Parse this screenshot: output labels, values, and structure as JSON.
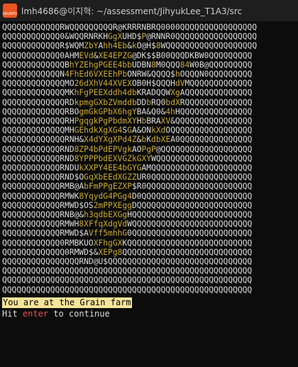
{
  "window": {
    "title": "lmh4686@이지혁: ~/assessment/JihyukLee_T1A3/src",
    "icon_label": "UBUNTU"
  },
  "art_lines": [
    "QQQQQQQQQQQQRWQQQQQQQQQR@KRRRNBRQ0000QQQQQQQQQQQQQQQQ",
    "QQQQQQQQQQQQ0&WQQRNRKHGgXUHD$P@RNNR0QQQQQQQQQQQQQQQQQ",
    "QQQQQQQQQQQQR$WQMZbYAhh4Eb&kO@H$8WQQQQQQQQQQQQQQQQQQQ",
    "QQQQQQQQQQQQ0AHMEVd&XE4EPZG@DK$$B00QQQDKBW0QQQQQQQQQ",
    "QQQQQQQQQQQQQBhYZEhgPGEE4bbUDBN8M0QQQ84W0B@QQQQQQQQQ",
    "QQQQQQQQQQQQN4FhEd6VXEEhPbONRW&QQQQ$hOQQQN0QQQQQQQQQ",
    "QQQQQQQQQQQQQMO26dXhV44XVEXOB0H$QQQHdVMQQQQQQQQQQQQQ",
    "QQQQQQQQQQQQQMKhFgPEEXddh4dbKRADQQWXgAQQQQQQQQQQQQQQ",
    "QQQQQQQQQQQQQRDkpmgGXbZVmddbDDbRQ0bdXRQQQQQQQQQQQQQQ",
    "QQQQQQQQQQQQQRBOgmGkGPbX6hgYBA&Q0&4hHQQQQQQQQQQQQQQQ",
    "QQQQQQQQQQQQQRHPgqgkPgPbdmXYHbBRAXV&QQQQQQQQQQQQQQQQ",
    "QQQQQQQQQQQQQMHGEhdkXgXG4SGA&ONkXdOQQQQQQQQQQQQQQQQQ",
    "QQQQQQQQQQQQQRNH&X4dYXgXPd4Z&bKdbXEA0QQQQQQQQQQQQQQQ",
    "QQQQQQQQQQQQRND8ZP4bPdEPVgkAOPgP@QQQQQQQQQQQQQQQQQQQ",
    "QQQQQQQQQQQQRND8YPPPbdEXVGZkGXYWQQQQQQQQQQQQQQQQQQQQ",
    "QQQQQQQQQQQQRNDUkXXPY4EE4bGYGAMQQQQQQQQQQQQQQQQQQQQQ",
    "QQQQQQQQQQQQRND$OGqXbEEdXGZZUR0QQQQQQQQQQQQQQQQQQQQQ",
    "QQQQQQQQQQQQRMB@AbFmPPgEZXP$R0QQQQQQQQQQQQQQQQQQQQQQ",
    "QQQQQQQQQQQQRMWK8YqydG4PGg4D0QQQQQQQQQQQQQQQQQQQQQQQ",
    "QQQQQQQQQQQQRMWD$OS2mPPXEggDQQQQQQQQQQQQQQQQQQQQQQQQ",
    "QQQQQQQQQQQQRNB@&h3qdbEXGgHQQQQQQQQQQQQQQQQQQQQQQQQQ",
    "QQQQQQQQQQQQRMWH8XFfqXdgVdWQQQQQQQQQQQQQQQQQQQQQQQQQ",
    "QQQQQQQQQQQQRMWD$AVff5mhhG0QQQQQQQQQQQQQQQQQQQQQQQQQ",
    "QQQQQQQQQQQQ0RMBKUOXFhgGXKQQQQQQQQQQQQQQQQQQQQQQQQQQ",
    "QQQQQQQQQQQQQ0RMWD$&XEPg8QQQQQQQQQQQQQQQQQQQQQQQQQQQ",
    "QQQQQQQQQQQQQQQQRND@U$QQQQQQQQQQQQQQQQQQQQQQQQQQQQQQ",
    "QQQQQQQQQQQQQQQQQQQQQQQQQQQQQQQQQQQQQQQQQQQQQQQQQQQQ",
    "QQQQQQQQQQQQQQQQQQQQQQQQQQQQQQQQQQQQQQQQQQQQQQQQQQQQ",
    "QQQQQQQQQQQQQQQQQQQQQQQQQQQQQQQQQQQQQQQQQQQQQQQQQQQQ"
  ],
  "message": "You are at the Grain farm",
  "prompt": {
    "before": "Hit ",
    "key": "enter",
    "after": " to continue"
  },
  "colors": {
    "highlight": "#c8a838",
    "message_bg": "#f5e49a",
    "key_color": "#e05050"
  }
}
